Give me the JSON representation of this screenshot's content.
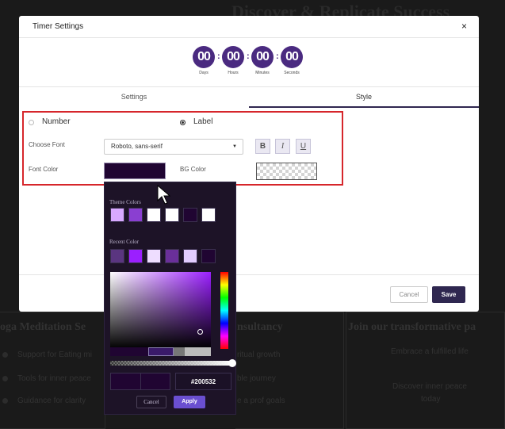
{
  "background": {
    "heading": "Discover & Replicate Success",
    "cards": [
      {
        "title": "oga Meditation Se",
        "lines": [
          "Support for Eating mi",
          "Tools for inner peace",
          "Guidance for clarity"
        ]
      },
      {
        "title": "nsultancy",
        "lines": [
          "ritual growth",
          "ble journey",
          "e a prof goals"
        ]
      },
      {
        "title": "Join our transformative pa",
        "lines": [
          "Embrace a fulfilled life",
          "Discover inner peace",
          "today"
        ]
      }
    ]
  },
  "modal": {
    "title": "Timer Settings",
    "close": "×"
  },
  "timer": {
    "units": [
      {
        "value": "00",
        "label": "Days"
      },
      {
        "value": "00",
        "label": "Hours"
      },
      {
        "value": "00",
        "label": "Minutes"
      },
      {
        "value": "00",
        "label": "Seconds"
      }
    ],
    "separator": ":",
    "badge_color": "#4a2a80"
  },
  "tabs": [
    {
      "label": "Settings",
      "active": false
    },
    {
      "label": "Style",
      "active": true
    }
  ],
  "style": {
    "display_options": [
      {
        "label": "Number",
        "checked": false
      },
      {
        "label": "Label",
        "checked": true
      }
    ],
    "choose_font_label": "Choose Font",
    "font_value": "Roboto, sans-serif",
    "format_buttons": [
      "B",
      "I",
      "U"
    ],
    "font_color_label": "Font Color",
    "font_color": "#200532",
    "bg_color_label": "BG Color"
  },
  "footer": {
    "cancel": "Cancel",
    "save": "Save",
    "save_color": "#2f2750"
  },
  "picker": {
    "theme_colors_title": "Theme Colors",
    "theme_colors": [
      "#d8a9ff",
      "#8a3fd1",
      "#ffffff",
      "#ffffff",
      "#200532",
      "#ffffff"
    ],
    "recent_colors_title": "Recent Color",
    "recent_colors": [
      "#5a3580",
      "#9b1fff",
      "#eeddff",
      "#6a2f9a",
      "#e2ccff",
      "#200532"
    ],
    "history_colors": [
      "#200532",
      "#3a1a6a",
      "#777777",
      "#bbbbbb"
    ],
    "hex_value": "#200532",
    "cancel": "Cancel",
    "apply": "Apply",
    "apply_color": "#6a4fd0"
  }
}
